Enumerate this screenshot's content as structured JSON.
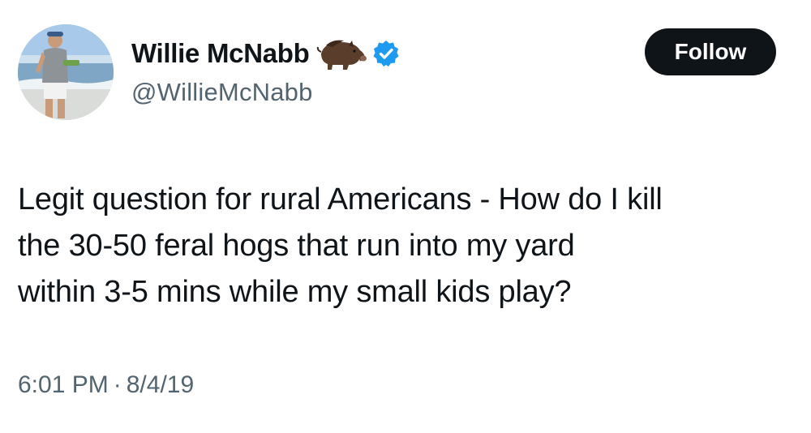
{
  "author": {
    "display_name": "Willie McNabb",
    "handle": "@WillieMcNabb",
    "name_emoji": "boar-icon",
    "verified_badge": "verified-icon",
    "verified_color": "#1d9bf0"
  },
  "follow_button": {
    "label": "Follow",
    "background": "#0f1419",
    "text_color": "#ffffff"
  },
  "tweet": {
    "text_lines": [
      "Legit question for rural Americans - How do I kill",
      "the 30-50 feral hogs that run into my yard",
      "within 3-5 mins while my small kids play?"
    ],
    "time": "6:01 PM",
    "separator": "·",
    "date": "8/4/19"
  },
  "colors": {
    "primary_text": "#0f1419",
    "secondary_text": "#536471",
    "background": "#ffffff"
  }
}
